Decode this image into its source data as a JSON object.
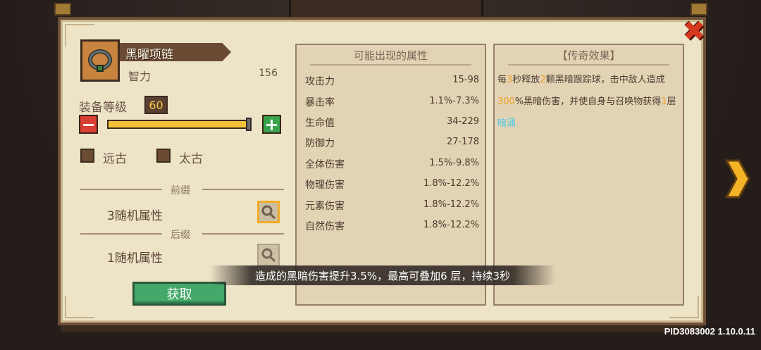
{
  "item": {
    "name": "黑曜项链",
    "stat_name": "智力",
    "stat_value": "156",
    "icon": "necklace-icon"
  },
  "level": {
    "label": "装备等级",
    "value": "60",
    "slider_fraction": 1.0
  },
  "checkboxes": [
    {
      "label": "远古",
      "checked": false
    },
    {
      "label": "太古",
      "checked": false
    }
  ],
  "prefix": {
    "divider_label": "前缀",
    "text": "3随机属性"
  },
  "suffix": {
    "divider_label": "后缀",
    "text": "1随机属性"
  },
  "get_button": "获取",
  "attributes": {
    "title": "可能出现的属性",
    "rows": [
      {
        "name": "攻击力",
        "value": "15-98"
      },
      {
        "name": "暴击率",
        "value": "1.1%-7.3%"
      },
      {
        "name": "生命值",
        "value": "34-229"
      },
      {
        "name": "防御力",
        "value": "27-178"
      },
      {
        "name": "全体伤害",
        "value": "1.5%-9.8%"
      },
      {
        "name": "物理伤害",
        "value": "1.8%-12.2%"
      },
      {
        "name": "元素伤害",
        "value": "1.8%-12.2%"
      },
      {
        "name": "自然伤害",
        "value": "1.8%-12.2%"
      }
    ]
  },
  "legendary": {
    "title": "【传奇效果】",
    "parts": [
      {
        "text": "每",
        "hl": ""
      },
      {
        "text": "3",
        "hl": "y"
      },
      {
        "text": "秒释放",
        "hl": ""
      },
      {
        "text": "2",
        "hl": "y"
      },
      {
        "text": "颗黑暗跟踪球，击中敌人造成",
        "hl": ""
      },
      {
        "text": "300",
        "hl": "y"
      },
      {
        "text": "%黑暗伤害，并使自身与召唤物获得",
        "hl": ""
      },
      {
        "text": "1",
        "hl": "y"
      },
      {
        "text": "层",
        "hl": ""
      },
      {
        "text": "暗涌",
        "hl": "c"
      }
    ]
  },
  "toast": "造成的黑暗伤害提升3.5%，最高可叠加6 层，持续3秒",
  "version": "PID3083002 1.10.0.11",
  "colors": {
    "panel": "#ede3c6",
    "accent_yellow": "#f0a12a",
    "accent_cyan": "#4fc8e8",
    "button_green": "#43a869",
    "button_red": "#d94033"
  }
}
